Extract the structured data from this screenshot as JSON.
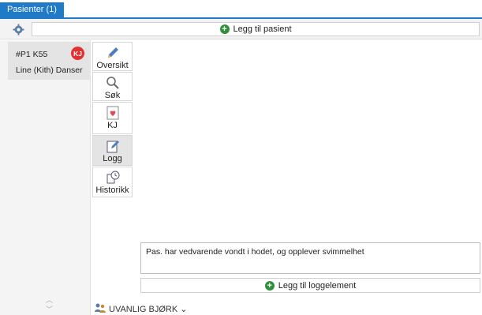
{
  "tabs": [
    {
      "label": "Pasienter (1)"
    }
  ],
  "toolbar": {
    "add_patient_label": "Legg til pasient",
    "settings_icon": "gear-group-icon"
  },
  "patient": {
    "id_label": "#P1 K55",
    "name": "Line (Kith) Danser",
    "badge": "KJ",
    "badge_color": "#e53030"
  },
  "nav": {
    "items": [
      {
        "label": "Oversikt",
        "icon": "pencil-icon"
      },
      {
        "label": "Søk",
        "icon": "search-icon"
      },
      {
        "label": "KJ",
        "icon": "heart-card-icon"
      },
      {
        "label": "Logg",
        "icon": "edit-note-icon",
        "selected": true
      },
      {
        "label": "Historikk",
        "icon": "history-icon"
      }
    ]
  },
  "log": {
    "entry_text": "Pas. har vedvarende vondt i hodet, og opplever svimmelhet",
    "add_label": "Legg til loggelement"
  },
  "footer": {
    "user_label": "UVANLIG BJØRK ⌄"
  },
  "colors": {
    "accent": "#1f7bc8",
    "add_green": "#2f8f3a"
  }
}
